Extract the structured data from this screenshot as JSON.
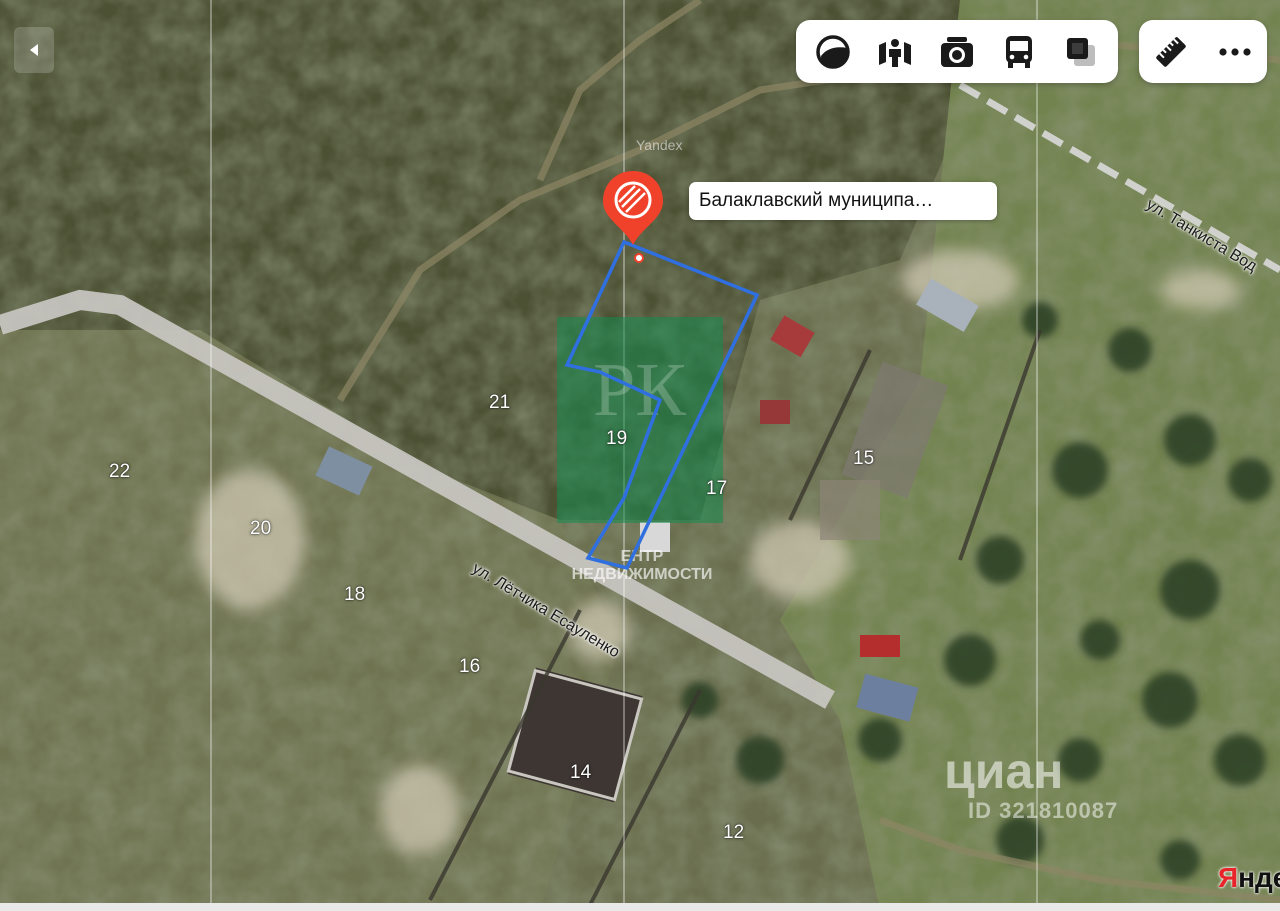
{
  "map": {
    "lot_numbers": [
      "21",
      "19",
      "17",
      "22",
      "20",
      "18",
      "16",
      "15",
      "14",
      "12"
    ],
    "streets": [
      "ул. Лётчика Есауленко",
      "ул. Танкиста Вод"
    ],
    "yandex_imagery_text": "Yandex",
    "pin": {
      "label": "Балаклавский муниципа…",
      "color": "#f0422b"
    },
    "parcel_outline_color": "#2f6fe0"
  },
  "toolbar": {
    "buttons": [
      "layers-icon",
      "panorama-icon",
      "photo-icon",
      "transport-icon",
      "overlay-icon"
    ],
    "extra_buttons": [
      "ruler-icon",
      "more-icon"
    ]
  },
  "watermarks": {
    "rk_letters": "РК",
    "rk_caption_line1": "ЕНТР",
    "rk_caption_line2": "НЕДВИЖИМОСТИ",
    "cian": "циан",
    "cian_id": "ID 321810087"
  },
  "logo": {
    "first_letter": "Я",
    "rest": "нде"
  }
}
